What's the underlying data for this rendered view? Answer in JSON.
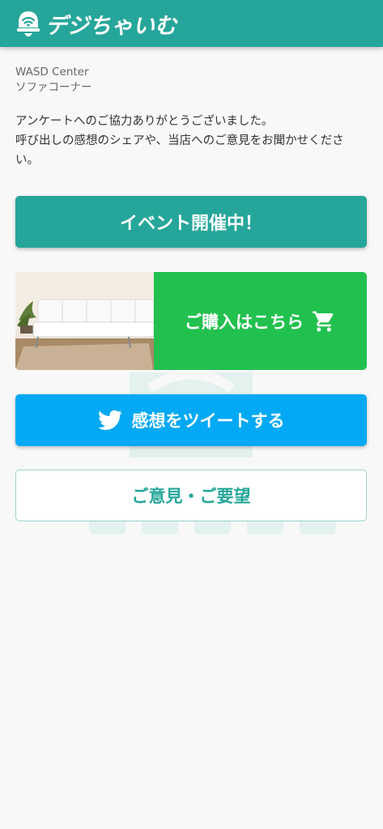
{
  "header": {
    "logo_text": "デジちゃいむ",
    "logo_icon": "bell-wifi-icon",
    "background": "#26a69a"
  },
  "store": {
    "name": "WASD Center",
    "location": "ソファコーナー"
  },
  "message": {
    "line1": "アンケートへのご協力ありがとうございました。",
    "line2": "呼び出しの感想のシェアや、当店へのご意見をお聞かせください。"
  },
  "buttons": {
    "event": {
      "label": "イベント開催中！",
      "color": "#26a69a"
    },
    "buy": {
      "label": "ご購入はこちら",
      "icon": "cart-icon",
      "color": "#22c14f",
      "image": "white-sofa-photo"
    },
    "tweet": {
      "label": "感想をツイートする",
      "icon": "twitter-bird-icon",
      "color": "#03a9f4"
    },
    "feedback": {
      "label": "ご意見・ご要望",
      "color": "#26a69a"
    }
  }
}
